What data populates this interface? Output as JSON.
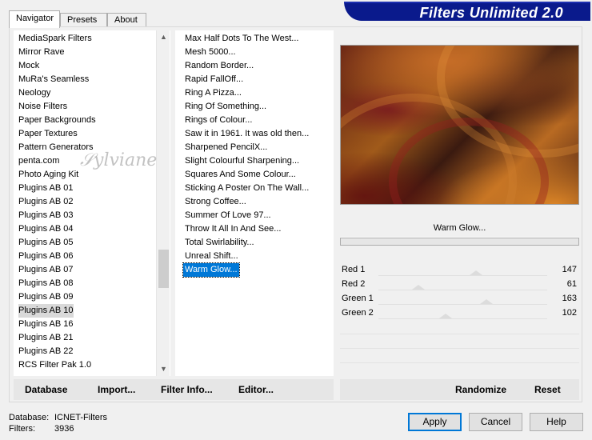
{
  "tabs": [
    {
      "label": "Navigator",
      "active": true
    },
    {
      "label": "Presets",
      "active": false
    },
    {
      "label": "About",
      "active": false
    }
  ],
  "banner": {
    "title": "Filters Unlimited 2.0"
  },
  "categories": {
    "items": [
      "MediaSpark Filters",
      "Mirror Rave",
      "Mock",
      "MuRa's Seamless",
      "Neology",
      "Noise Filters",
      "Paper Backgrounds",
      "Paper Textures",
      "Pattern Generators",
      "penta.com",
      "Photo Aging Kit",
      "Plugins AB 01",
      "Plugins AB 02",
      "Plugins AB 03",
      "Plugins AB 04",
      "Plugins AB 05",
      "Plugins AB 06",
      "Plugins AB 07",
      "Plugins AB 08",
      "Plugins AB 09",
      "Plugins AB 10",
      "Plugins AB 16",
      "Plugins AB 21",
      "Plugins AB 22",
      "RCS Filter Pak 1.0"
    ],
    "selected": "Plugins AB 10"
  },
  "filters": {
    "items": [
      "Max Half Dots To The West...",
      "Mesh 5000...",
      "Random Border...",
      "Rapid FallOff...",
      "Ring A Pizza...",
      "Ring Of Something...",
      "Rings of Colour...",
      "Saw it in 1961. It was old then...",
      "Sharpened PencilX...",
      "Slight Colourful Sharpening...",
      "Squares And Some Colour...",
      "Sticking A Poster On The Wall...",
      "Strong Coffee...",
      "Summer Of Love 97...",
      "Throw It All In And See...",
      "Total Swirlability...",
      "Unreal Shift...",
      "Warm Glow..."
    ],
    "selected": "Warm Glow..."
  },
  "preview": {
    "filter_name": "Warm Glow..."
  },
  "params": [
    {
      "label": "Red 1",
      "value": 147,
      "max": 255
    },
    {
      "label": "Red 2",
      "value": 61,
      "max": 255
    },
    {
      "label": "Green 1",
      "value": 163,
      "max": 255
    },
    {
      "label": "Green 2",
      "value": 102,
      "max": 255
    }
  ],
  "actions": {
    "database": "Database",
    "import": "Import...",
    "filter_info": "Filter Info...",
    "editor": "Editor...",
    "randomize": "Randomize",
    "reset": "Reset"
  },
  "footer": {
    "database_label": "Database:",
    "database_value": "ICNET-Filters",
    "filters_label": "Filters:",
    "filters_value": "3936"
  },
  "buttons": {
    "apply": "Apply",
    "cancel": "Cancel",
    "help": "Help"
  },
  "watermark": "Sylviane"
}
